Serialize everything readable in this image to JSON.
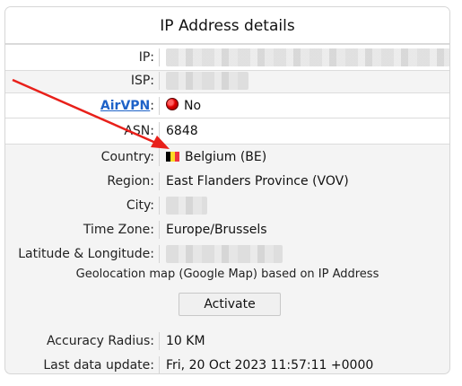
{
  "title": "IP Address details",
  "rows": {
    "ip": {
      "label": "IP:"
    },
    "isp": {
      "label": "ISP:"
    },
    "airvpn": {
      "label_link": "AirVPN",
      "colon": ":",
      "value": "No"
    },
    "asn": {
      "label": "ASN:",
      "value": "6848"
    },
    "country": {
      "label": "Country:",
      "value": "Belgium (BE)"
    },
    "region": {
      "label": "Region:",
      "value": "East Flanders Province (VOV)"
    },
    "city": {
      "label": "City:"
    },
    "timezone": {
      "label": "Time Zone:",
      "value": "Europe/Brussels"
    },
    "latlng": {
      "label": "Latitude & Longitude:"
    }
  },
  "geolocation": {
    "text": "Geolocation map (Google Map) based on IP Address",
    "button_label": "Activate"
  },
  "accuracy": {
    "label": "Accuracy Radius:",
    "value": "10 KM"
  },
  "last_update": {
    "label": "Last data update:",
    "value": "Fri, 20 Oct 2023 11:57:11 +0000"
  },
  "colors": {
    "link": "#1e62c8",
    "status_dot": "#e00000",
    "arrow": "#e8201a",
    "flag": [
      "#000000",
      "#fdda24",
      "#ef3340"
    ]
  },
  "icons": [
    "red-status-dot-icon",
    "belgium-flag-icon",
    "red-arrow-annotation"
  ]
}
